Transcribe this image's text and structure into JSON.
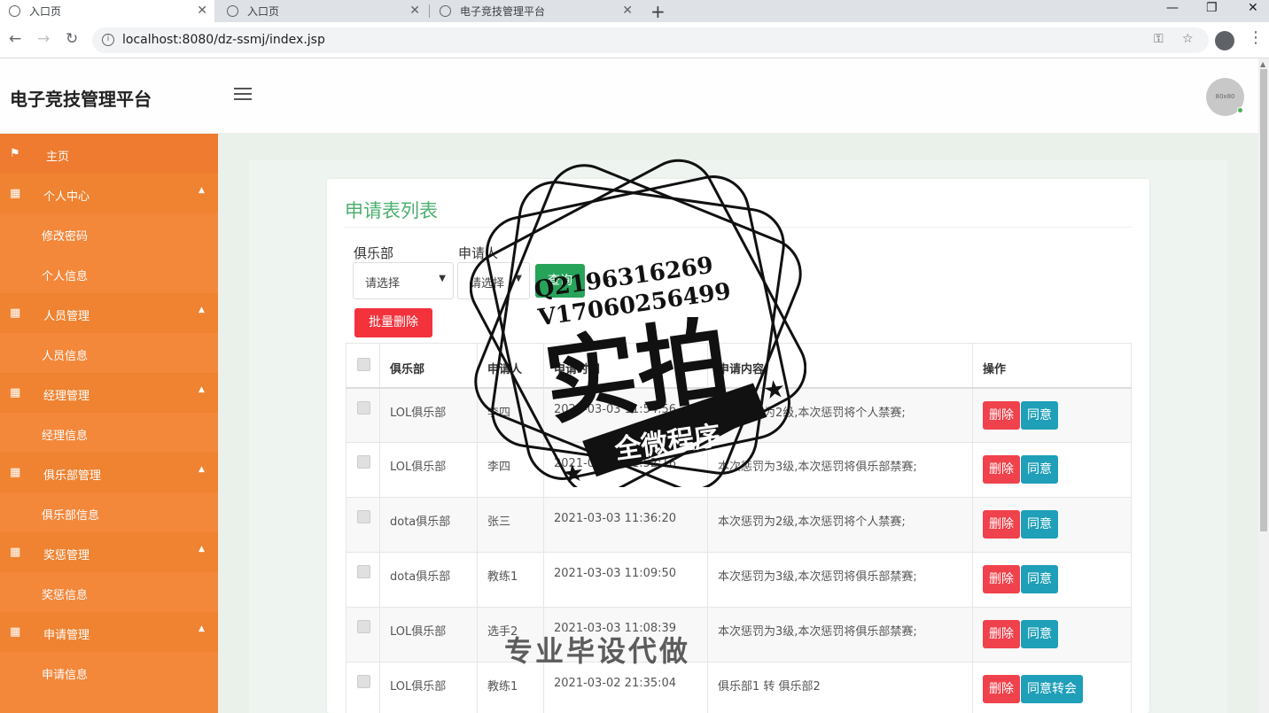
{
  "browser": {
    "tabs": [
      {
        "title": "入口页"
      },
      {
        "title": "入口页"
      },
      {
        "title": "电子竞技管理平台"
      }
    ],
    "url": "localhost:8080/dz-ssmj/index.jsp"
  },
  "header": {
    "brand": "电子竞技管理平台",
    "avatar_text": "80x80"
  },
  "sidebar": {
    "items": [
      {
        "label": "主页",
        "type": "home"
      },
      {
        "label": "个人中心",
        "type": "parent"
      },
      {
        "label": "修改密码",
        "type": "sub"
      },
      {
        "label": "个人信息",
        "type": "sub"
      },
      {
        "label": "人员管理",
        "type": "parent"
      },
      {
        "label": "人员信息",
        "type": "sub"
      },
      {
        "label": "经理管理",
        "type": "parent"
      },
      {
        "label": "经理信息",
        "type": "sub"
      },
      {
        "label": "俱乐部管理",
        "type": "parent"
      },
      {
        "label": "俱乐部信息",
        "type": "sub"
      },
      {
        "label": "奖惩管理",
        "type": "parent"
      },
      {
        "label": "奖惩信息",
        "type": "sub"
      },
      {
        "label": "申请管理",
        "type": "parent"
      },
      {
        "label": "申请信息",
        "type": "sub"
      }
    ]
  },
  "main": {
    "title": "申请表列表",
    "filters": {
      "club_label": "俱乐部",
      "club_value": "请选择",
      "applicant_label": "申请人",
      "applicant_value": "请选择",
      "query_label": "查询"
    },
    "batch_delete_label": "批量删除",
    "columns": [
      "俱乐部",
      "申请人",
      "申请时间",
      "申请内容",
      "操作"
    ],
    "rows": [
      {
        "club": "LOL俱乐部",
        "applicant": "李四",
        "time": "2021-03-03 11:54:56",
        "content": "本次惩罚为2级,本次惩罚将个人禁赛;",
        "del": "删除",
        "ok": "同意"
      },
      {
        "club": "LOL俱乐部",
        "applicant": "李四",
        "time": "2021-03-03 11:52:16",
        "content": "本次惩罚为3级,本次惩罚将俱乐部禁赛;",
        "del": "删除",
        "ok": "同意"
      },
      {
        "club": "dota俱乐部",
        "applicant": "张三",
        "time": "2021-03-03 11:36:20",
        "content": "本次惩罚为2级,本次惩罚将个人禁赛;",
        "del": "删除",
        "ok": "同意"
      },
      {
        "club": "dota俱乐部",
        "applicant": "教练1",
        "time": "2021-03-03 11:09:50",
        "content": "本次惩罚为3级,本次惩罚将俱乐部禁赛;",
        "del": "删除",
        "ok": "同意"
      },
      {
        "club": "LOL俱乐部",
        "applicant": "选手2",
        "time": "2021-03-03 11:08:39",
        "content": "本次惩罚为3级,本次惩罚将俱乐部禁赛;",
        "del": "删除",
        "ok": "同意"
      },
      {
        "club": "LOL俱乐部",
        "applicant": "教练1",
        "time": "2021-03-02 21:35:04",
        "content": "俱乐部1 转 俱乐部2",
        "del": "删除",
        "ok": "同意转会"
      }
    ]
  },
  "watermark": {
    "qq": "Q2196316269",
    "vx": "V17060256499",
    "big": "实拍",
    "banner": "全微程序",
    "bottom": "专业毕设代做"
  },
  "colors": {
    "sidebar": "#f3873a",
    "accent_green": "#4caf6f",
    "danger": "#f0424c",
    "info": "#1f9fb8",
    "success": "#27a35a"
  }
}
